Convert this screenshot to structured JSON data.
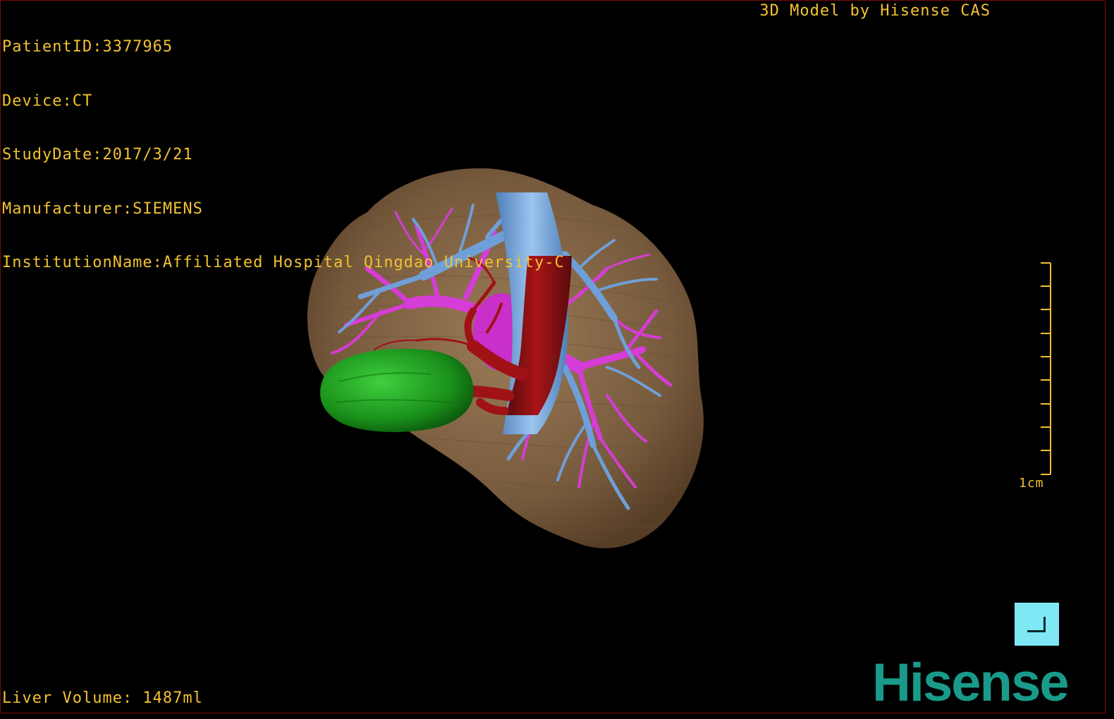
{
  "overlay": {
    "patient_id": "PatientID:3377965",
    "device": "Device:CT",
    "study_date": "StudyDate:2017/3/21",
    "manufacturer": "Manufacturer:SIEMENS",
    "institution": "InstitutionName:Affiliated Hospital Qingdao University-C",
    "credit": "3D Model by Hisense CAS",
    "liver_volume": "Liver Volume: 1487ml"
  },
  "scale_bar": {
    "label": "1cm"
  },
  "brand": {
    "logo_text": "Hisense"
  },
  "colors": {
    "text": "#f2c230",
    "liver": "#8a6a48",
    "portal_vein": "#6f9fd8",
    "hepatic_vein": "#d63cd6",
    "aorta": "#8c0f12",
    "gallbladder": "#1f9a1f",
    "corner_button": "#7fe8f4",
    "brand": "#1a9a8a"
  },
  "icons": {
    "corner_button": "corner-bracket-icon"
  }
}
